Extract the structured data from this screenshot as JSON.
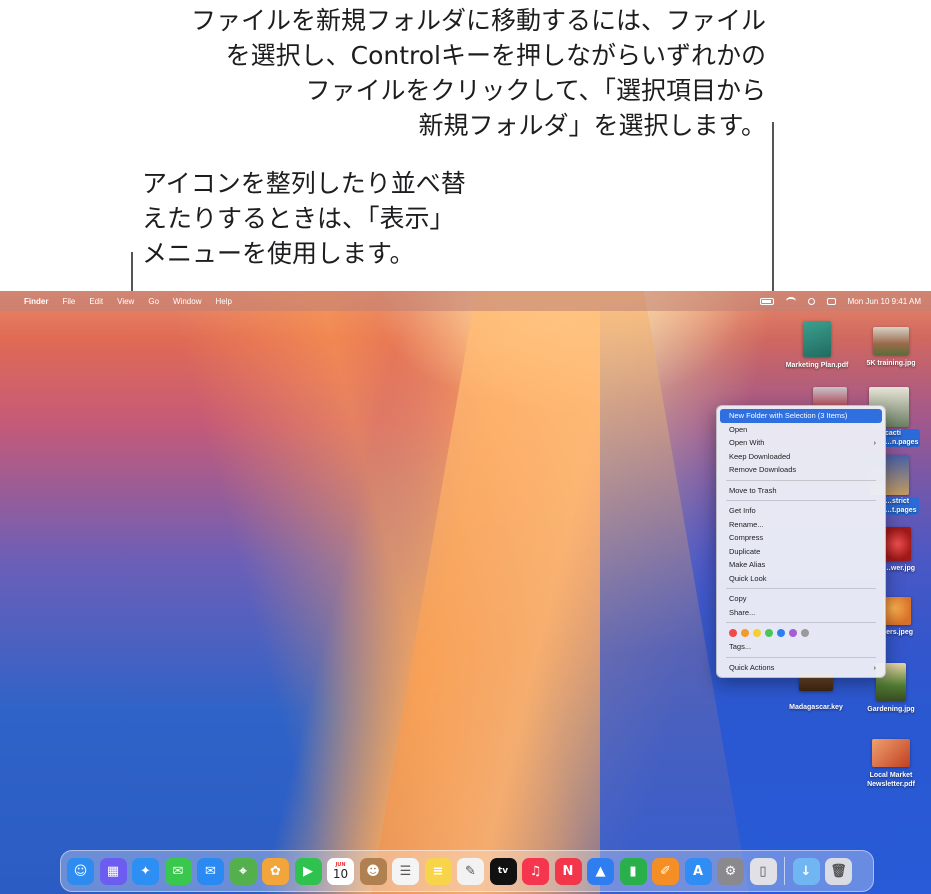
{
  "callouts": {
    "move_to_folder": "ファイルを新規フォルダに移動するには、ファイル\nを選択し、Controlキーを押しながらいずれかの\nファイルをクリックして、「選択項目から\n新規フォルダ」を選択します。",
    "view_menu": "アイコンを整列したり並べ替\nえたりするときは、「表示」\nメニューを使用します。"
  },
  "menubar": {
    "app_name": "Finder",
    "menus": [
      "File",
      "Edit",
      "View",
      "Go",
      "Window",
      "Help"
    ],
    "datetime": "Mon Jun 10  9:41 AM"
  },
  "desktop_icons": [
    {
      "label": "Marketing Plan.pdf",
      "color": "#2e8a7a"
    },
    {
      "label": "5K training.jpg",
      "color": "#9a6a4a"
    },
    {
      "label": "cacti\n…n.pages",
      "color": "#6b7f62"
    },
    {
      "label": "…strict\n…t.pages",
      "color": "#c29b61"
    },
    {
      "label": "…wer.jpg",
      "color": "#c32222"
    },
    {
      "label": "…ers.jpeg",
      "color": "#d8722a"
    },
    {
      "label": "Madagascar.key",
      "color": "#5a3a22"
    },
    {
      "label": "Gardening.jpg",
      "color": "#4f7c32"
    },
    {
      "label": "Local Market\nNewsletter.pdf",
      "color": "#e07040"
    }
  ],
  "context_menu": {
    "items": [
      "New Folder with Selection (3 Items)",
      "Open",
      "Open With",
      "Keep Downloaded",
      "Remove Downloads",
      "Move to Trash",
      "Get Info",
      "Rename...",
      "Compress",
      "Duplicate",
      "Make Alias",
      "Quick Look",
      "Copy",
      "Share...",
      "Tags...",
      "Quick Actions"
    ],
    "tag_colors": [
      "#ef4b4b",
      "#f39a2e",
      "#f5cf2f",
      "#4bc45a",
      "#2f7ff0",
      "#a45fd6",
      "#9a9a9a"
    ]
  },
  "calendar_tile": {
    "month": "JUN",
    "day": "10"
  },
  "tv_label": "tv",
  "dock": {
    "apps": [
      {
        "name": "finder-icon",
        "color": "#2e8cf0",
        "glyph": "☺"
      },
      {
        "name": "launchpad-icon",
        "color": "#6d5cf0",
        "glyph": "▦"
      },
      {
        "name": "safari-icon",
        "color": "#2d8ff3",
        "glyph": "✦"
      },
      {
        "name": "messages-icon",
        "color": "#39c74e",
        "glyph": "✉"
      },
      {
        "name": "mail-icon",
        "color": "#2b8af2",
        "glyph": "✉"
      },
      {
        "name": "maps-icon",
        "color": "#53b04c",
        "glyph": "⌖"
      },
      {
        "name": "photos-icon",
        "color": "#f2a53a",
        "glyph": "✿"
      },
      {
        "name": "facetime-icon",
        "color": "#30c24f",
        "glyph": "▶"
      },
      {
        "name": "calendar-icon",
        "color": "#ffffff",
        "glyph": ""
      },
      {
        "name": "contacts-icon",
        "color": "#b08050",
        "glyph": "☻"
      },
      {
        "name": "reminders-icon",
        "color": "#f4f4f4",
        "glyph": "☰"
      },
      {
        "name": "notes-icon",
        "color": "#f7d449",
        "glyph": "≡"
      },
      {
        "name": "freeform-icon",
        "color": "#f2f2f2",
        "glyph": "✎"
      },
      {
        "name": "tv-icon",
        "color": "#111111",
        "glyph": ""
      },
      {
        "name": "music-icon",
        "color": "#f5364e",
        "glyph": "♫"
      },
      {
        "name": "news-icon",
        "color": "#f4364a",
        "glyph": "N"
      },
      {
        "name": "keynote-icon",
        "color": "#2e7ef2",
        "glyph": "▲"
      },
      {
        "name": "numbers-icon",
        "color": "#29b04a",
        "glyph": "▮"
      },
      {
        "name": "pages-icon",
        "color": "#f48e25",
        "glyph": "✐"
      },
      {
        "name": "app-store-icon",
        "color": "#2f8df3",
        "glyph": "A"
      },
      {
        "name": "system-settings-icon",
        "color": "#8a8a8e",
        "glyph": "⚙"
      },
      {
        "name": "iphone-mirroring-icon",
        "color": "#e0e0e6",
        "glyph": "▯"
      },
      {
        "name": "downloads-folder-icon",
        "color": "#6fb6f2",
        "glyph": "↓"
      },
      {
        "name": "trash-icon",
        "color": "#d9dde3",
        "glyph": "🗑"
      }
    ]
  }
}
